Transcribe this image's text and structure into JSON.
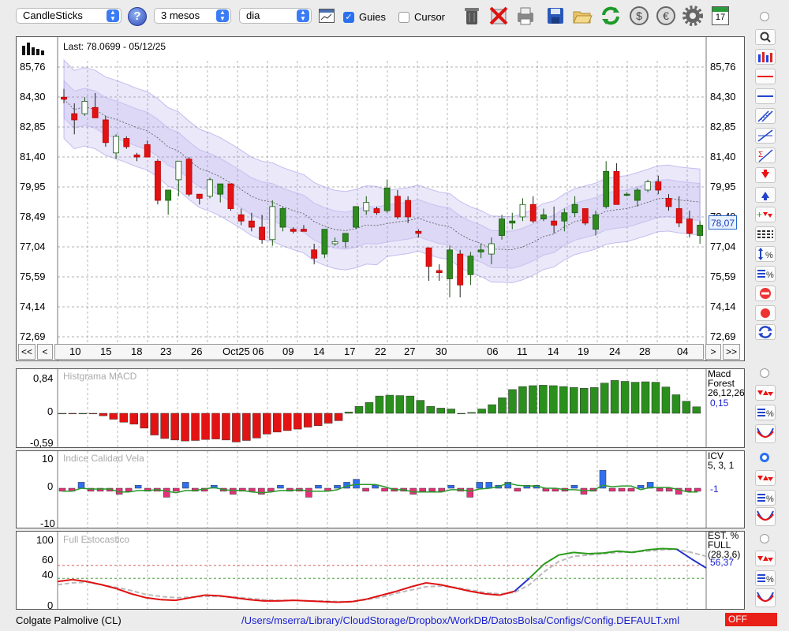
{
  "toolbar": {
    "chart_type": "CandleSticks",
    "help": "?",
    "period": "3 mesos",
    "interval": "dia",
    "guides_label": "Guies",
    "guides_checked": true,
    "cursor_label": "Cursor",
    "cursor_checked": false,
    "calendar_day": "17"
  },
  "main": {
    "last_info": "Last: 78.0699 - 05/12/25",
    "price_tag": "78,07",
    "y_ticks": [
      "85,76",
      "84,30",
      "82,85",
      "81,40",
      "79,95",
      "78,49",
      "77,04",
      "75,59",
      "74,14",
      "72,69"
    ],
    "x_ticks": [
      "10",
      "15",
      "18",
      "23",
      "26",
      "Oct25",
      "06",
      "09",
      "14",
      "17",
      "22",
      "27",
      "30",
      "06",
      "11",
      "14",
      "19",
      "24",
      "28",
      "04"
    ],
    "nav_first": "<<",
    "nav_prev": "<",
    "nav_next": ">",
    "nav_last": ">>"
  },
  "macd": {
    "title": "Histgrama MACD",
    "y_top": "0,84",
    "y_mid": "0",
    "y_bot": "-0,59",
    "label_name": "Macd",
    "label_type": "Forest",
    "label_params": "26,12,26",
    "value": "0,15"
  },
  "icv": {
    "title": "Indice Calidad Vela",
    "y_top": "10",
    "y_mid": "0",
    "y_bot": "-10",
    "label_name": "ICV",
    "label_params": "5, 3, 1",
    "value": "-1"
  },
  "stoch": {
    "title": "Full Estocastico",
    "y_100": "100",
    "y_60": "60",
    "y_40": "40",
    "y_0": "0",
    "label_name": "EST. %",
    "label_type": "FULL",
    "label_params": "(28,3,6)",
    "value": "56,37"
  },
  "status": {
    "ticker": "Colgate Palmolive (CL)",
    "path": "/Users/mserra/Library/CloudStorage/Dropbox/WorkDB/DatosBolsa/Configs/Config.DEFAULT.xml",
    "off": "OFF"
  },
  "colors": {
    "up": "#2e8b1e",
    "down": "#e31313",
    "band": "#8a7fe0",
    "link": "#1a20d0"
  },
  "chart_data": [
    {
      "type": "candlestick",
      "title": "",
      "ylim": [
        72.69,
        85.76
      ],
      "candles": [
        {
          "o": 84.3,
          "h": 84.7,
          "l": 84.0,
          "c": 84.2
        },
        {
          "o": 83.5,
          "h": 84.0,
          "l": 82.5,
          "c": 83.2
        },
        {
          "o": 83.5,
          "h": 84.3,
          "l": 83.4,
          "c": 84.1
        },
        {
          "o": 83.8,
          "h": 84.5,
          "l": 83.5,
          "c": 83.3
        },
        {
          "o": 83.2,
          "h": 83.4,
          "l": 81.9,
          "c": 82.1
        },
        {
          "o": 81.6,
          "h": 82.5,
          "l": 81.3,
          "c": 82.4
        },
        {
          "o": 82.3,
          "h": 82.4,
          "l": 81.8,
          "c": 81.9
        },
        {
          "o": 81.5,
          "h": 81.6,
          "l": 81.2,
          "c": 81.4
        },
        {
          "o": 82.0,
          "h": 82.2,
          "l": 81.4,
          "c": 81.4
        },
        {
          "o": 81.2,
          "h": 81.3,
          "l": 79.1,
          "c": 79.3
        },
        {
          "o": 79.3,
          "h": 79.8,
          "l": 78.6,
          "c": 79.8
        },
        {
          "o": 80.3,
          "h": 80.8,
          "l": 79.5,
          "c": 81.2
        },
        {
          "o": 81.3,
          "h": 81.4,
          "l": 79.5,
          "c": 79.6
        },
        {
          "o": 79.6,
          "h": 79.6,
          "l": 79.1,
          "c": 79.4
        },
        {
          "o": 79.5,
          "h": 80.4,
          "l": 79.4,
          "c": 80.3
        },
        {
          "o": 79.6,
          "h": 80.0,
          "l": 79.2,
          "c": 80.1
        },
        {
          "o": 80.1,
          "h": 80.1,
          "l": 78.8,
          "c": 78.9
        },
        {
          "o": 78.6,
          "h": 78.9,
          "l": 78.1,
          "c": 78.3
        },
        {
          "o": 78.3,
          "h": 78.7,
          "l": 77.8,
          "c": 78.0
        },
        {
          "o": 78.0,
          "h": 78.6,
          "l": 77.2,
          "c": 77.4
        },
        {
          "o": 77.4,
          "h": 79.3,
          "l": 77.1,
          "c": 79.0
        },
        {
          "o": 78.0,
          "h": 79.0,
          "l": 77.8,
          "c": 78.9
        },
        {
          "o": 77.9,
          "h": 78.0,
          "l": 77.7,
          "c": 77.8
        },
        {
          "o": 77.9,
          "h": 78.1,
          "l": 77.8,
          "c": 77.8
        },
        {
          "o": 76.9,
          "h": 77.2,
          "l": 76.2,
          "c": 76.5
        },
        {
          "o": 76.7,
          "h": 77.9,
          "l": 76.5,
          "c": 77.9
        },
        {
          "o": 77.2,
          "h": 77.5,
          "l": 77.1,
          "c": 77.3
        },
        {
          "o": 77.3,
          "h": 77.7,
          "l": 77.0,
          "c": 77.7
        },
        {
          "o": 78.0,
          "h": 79.0,
          "l": 77.9,
          "c": 79.0
        },
        {
          "o": 78.8,
          "h": 79.5,
          "l": 78.6,
          "c": 79.2
        },
        {
          "o": 78.9,
          "h": 79.0,
          "l": 78.6,
          "c": 78.7
        },
        {
          "o": 78.8,
          "h": 80.3,
          "l": 78.7,
          "c": 79.9
        },
        {
          "o": 79.5,
          "h": 79.8,
          "l": 78.4,
          "c": 78.5
        },
        {
          "o": 79.3,
          "h": 79.5,
          "l": 78.2,
          "c": 78.5
        },
        {
          "o": 77.8,
          "h": 77.9,
          "l": 77.5,
          "c": 77.7
        },
        {
          "o": 77.0,
          "h": 77.0,
          "l": 75.4,
          "c": 76.1
        },
        {
          "o": 75.9,
          "h": 76.2,
          "l": 75.4,
          "c": 75.8
        },
        {
          "o": 75.5,
          "h": 77.1,
          "l": 74.6,
          "c": 76.9
        },
        {
          "o": 76.7,
          "h": 76.9,
          "l": 74.6,
          "c": 75.2
        },
        {
          "o": 75.7,
          "h": 76.8,
          "l": 75.2,
          "c": 76.6
        },
        {
          "o": 76.8,
          "h": 77.2,
          "l": 76.5,
          "c": 76.9
        },
        {
          "o": 76.7,
          "h": 77.5,
          "l": 76.2,
          "c": 77.2
        },
        {
          "o": 77.6,
          "h": 78.6,
          "l": 77.4,
          "c": 78.4
        },
        {
          "o": 78.2,
          "h": 78.7,
          "l": 77.9,
          "c": 78.3
        },
        {
          "o": 78.5,
          "h": 79.4,
          "l": 78.3,
          "c": 79.1
        },
        {
          "o": 79.1,
          "h": 79.5,
          "l": 78.2,
          "c": 78.3
        },
        {
          "o": 78.4,
          "h": 78.9,
          "l": 78.3,
          "c": 78.6
        },
        {
          "o": 78.3,
          "h": 79.0,
          "l": 77.7,
          "c": 78.1
        },
        {
          "o": 78.3,
          "h": 78.9,
          "l": 77.8,
          "c": 78.7
        },
        {
          "o": 78.7,
          "h": 79.5,
          "l": 78.5,
          "c": 79.1
        },
        {
          "o": 78.9,
          "h": 78.9,
          "l": 78.1,
          "c": 78.2
        },
        {
          "o": 77.9,
          "h": 78.8,
          "l": 77.6,
          "c": 78.6
        },
        {
          "o": 79.0,
          "h": 81.2,
          "l": 78.9,
          "c": 80.7
        },
        {
          "o": 80.7,
          "h": 81.1,
          "l": 79.3,
          "c": 79.1
        },
        {
          "o": 79.6,
          "h": 79.7,
          "l": 79.5,
          "c": 79.6
        },
        {
          "o": 79.3,
          "h": 79.9,
          "l": 79.0,
          "c": 79.8
        },
        {
          "o": 79.8,
          "h": 80.3,
          "l": 79.7,
          "c": 80.2
        },
        {
          "o": 80.2,
          "h": 80.5,
          "l": 79.6,
          "c": 79.8
        },
        {
          "o": 79.4,
          "h": 79.6,
          "l": 78.8,
          "c": 79.0
        },
        {
          "o": 78.9,
          "h": 79.5,
          "l": 78.0,
          "c": 78.2
        },
        {
          "o": 78.4,
          "h": 78.8,
          "l": 77.5,
          "c": 77.7
        },
        {
          "o": 77.6,
          "h": 78.3,
          "l": 77.2,
          "c": 78.1
        }
      ]
    },
    {
      "type": "bar",
      "title": "Histgrama MACD",
      "ylim": [
        -0.59,
        0.84
      ],
      "values": [
        0,
        -0.01,
        0,
        -0.01,
        -0.05,
        -0.12,
        -0.18,
        -0.22,
        -0.3,
        -0.44,
        -0.51,
        -0.54,
        -0.56,
        -0.55,
        -0.53,
        -0.52,
        -0.54,
        -0.58,
        -0.55,
        -0.5,
        -0.42,
        -0.38,
        -0.35,
        -0.32,
        -0.28,
        -0.25,
        -0.2,
        -0.15,
        0.03,
        0.16,
        0.25,
        0.4,
        0.42,
        0.41,
        0.4,
        0.3,
        0.16,
        0.12,
        0.1,
        0,
        0.02,
        0.1,
        0.2,
        0.36,
        0.55,
        0.62,
        0.64,
        0.65,
        0.64,
        0.62,
        0.6,
        0.58,
        0.6,
        0.7,
        0.76,
        0.74,
        0.72,
        0.73,
        0.72,
        0.61,
        0.43,
        0.28,
        0.15
      ]
    },
    {
      "type": "bar",
      "title": "Indice Calidad Vela",
      "ylim": [
        -10,
        10
      ],
      "values": [
        -1,
        -1,
        2,
        -1,
        -1,
        -1,
        -2,
        -1,
        1,
        -1,
        -1,
        -3,
        -1,
        2,
        -1,
        -1,
        1,
        -1,
        -2,
        -1,
        -1,
        -2,
        -1,
        1,
        -1,
        -1,
        -3,
        1,
        -1,
        1,
        2,
        3,
        -1,
        1,
        -1,
        -1,
        -1,
        -2,
        -1,
        -1,
        -1,
        1,
        -1,
        -3,
        2,
        2,
        1,
        2,
        -1,
        1,
        1,
        -1,
        -1,
        -1,
        1,
        -2,
        -1,
        6,
        -1,
        -1,
        -1,
        1,
        2,
        -1,
        -1,
        -2,
        -1,
        -1
      ]
    },
    {
      "type": "line",
      "title": "Full Estocastico",
      "ylim": [
        0,
        100
      ],
      "series": [
        {
          "values": [
            35,
            38,
            35,
            30,
            24,
            16,
            10,
            7,
            6,
            10,
            14,
            13,
            10,
            7,
            5,
            5,
            6,
            5,
            4,
            3,
            4,
            8,
            14,
            20,
            27,
            33,
            30,
            25,
            20,
            16,
            14,
            20,
            40,
            62,
            76,
            80,
            78,
            79,
            82,
            80,
            84,
            86,
            85,
            70,
            56
          ]
        },
        {
          "values": [
            30,
            33,
            34,
            30,
            26,
            21,
            15,
            12,
            10,
            11,
            12,
            12,
            11,
            9,
            7,
            6,
            6,
            5,
            5,
            4,
            4,
            7,
            11,
            17,
            22,
            27,
            28,
            26,
            22,
            18,
            16,
            18,
            30,
            50,
            66,
            74,
            76,
            78,
            80,
            81,
            82,
            84,
            85,
            80,
            74
          ]
        }
      ]
    }
  ]
}
